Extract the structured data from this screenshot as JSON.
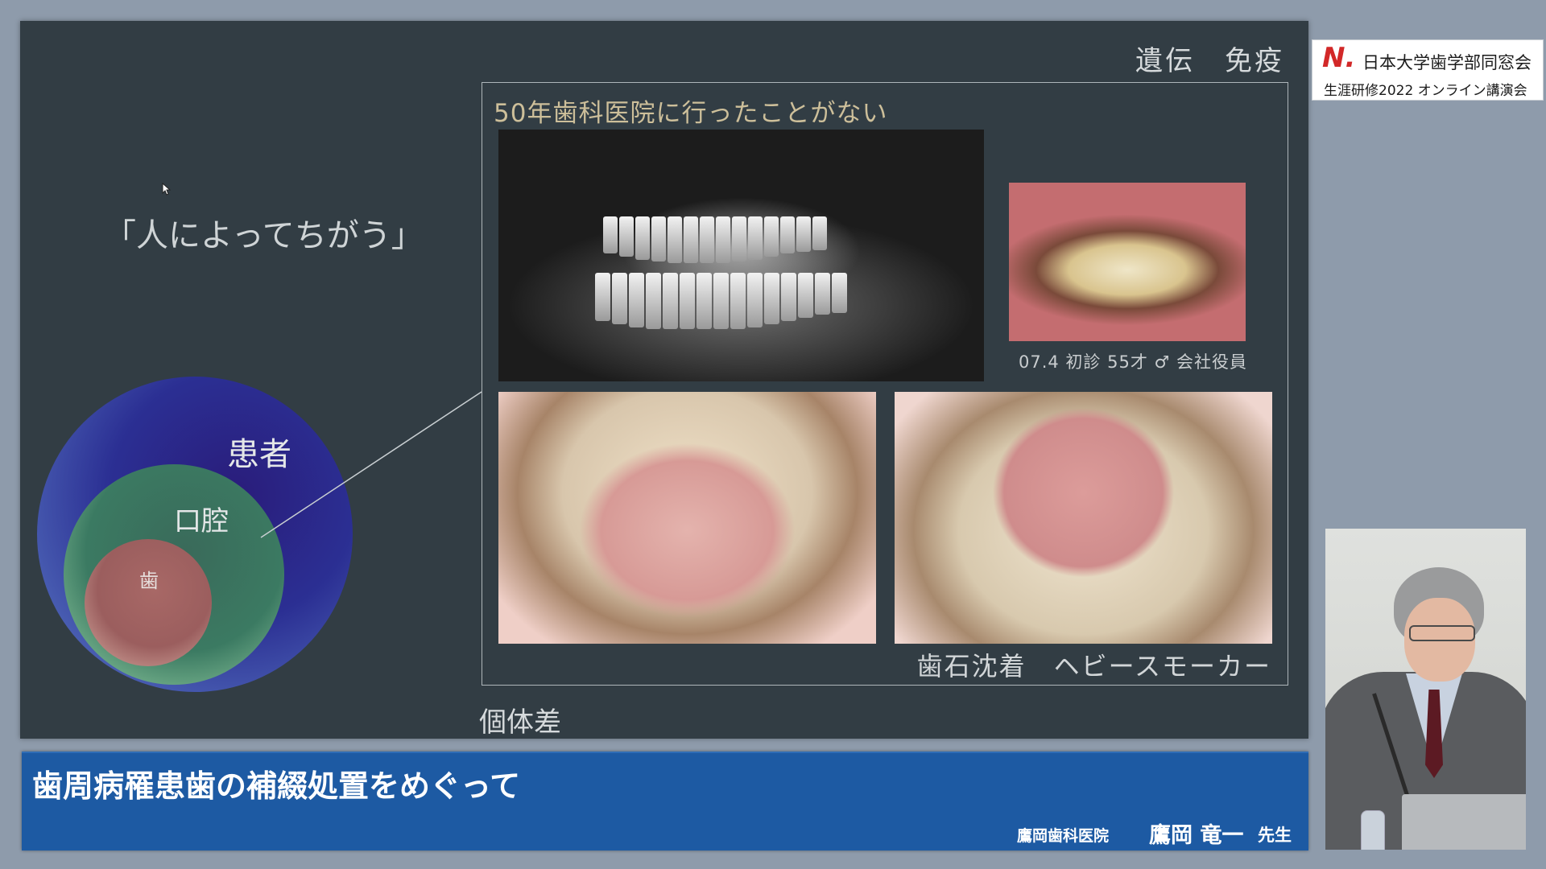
{
  "slide": {
    "tag_top": "遺伝　免疫",
    "quote": "「人によってちがう」",
    "bottom_label": "個体差",
    "frame": {
      "title": "50年歯科医院に行ったことがない",
      "face_caption": "07.4 初診 55才 ♂ 会社役員",
      "lower_caption": "歯石沈着　ヘビースモーカー"
    },
    "venn": {
      "outer": "患者",
      "middle": "口腔",
      "inner": "歯",
      "colors": {
        "outer": "#2b2f93",
        "middle": "#3b7a62",
        "inner": "#9b5e5e"
      }
    }
  },
  "logo": {
    "mark": "N.",
    "line1": "日本大学歯学部同窓会",
    "line2": "生涯研修2022 オンライン講演会",
    "mark_color": "#d22828"
  },
  "banner": {
    "title": "歯周病罹患歯の補綴処置をめぐって",
    "clinic": "鷹岡歯科医院",
    "speaker": "鷹岡 竜一",
    "honorific": "先生",
    "color": "#1d5aa3"
  },
  "icons": {
    "cursor": "mouse-pointer-icon"
  }
}
